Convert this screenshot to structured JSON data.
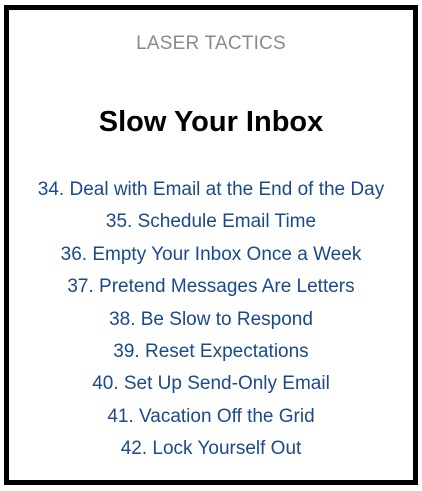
{
  "header": {
    "section_label": "LASER TACTICS",
    "title": "Slow Your Inbox"
  },
  "colors": {
    "link": "#1a4a8a",
    "section_label": "#8a8a8a",
    "border": "#000000"
  },
  "toc": {
    "items": [
      "34. Deal with Email at the End of the Day",
      "35. Schedule Email Time",
      "36. Empty Your Inbox Once a Week",
      "37. Pretend Messages Are Letters",
      "38. Be Slow to Respond",
      "39. Reset Expectations",
      "40. Set Up Send-Only Email",
      "41. Vacation Off the Grid",
      "42. Lock Yourself Out"
    ]
  }
}
